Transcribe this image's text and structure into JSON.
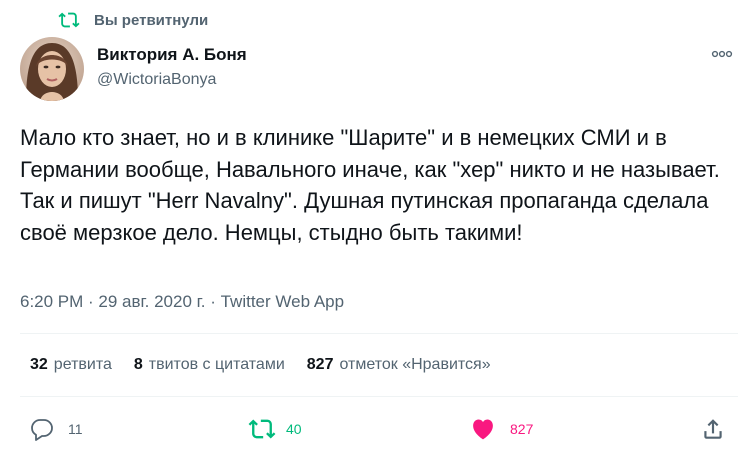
{
  "context": {
    "label": "Вы ретвитнули",
    "icon": "retweet-icon"
  },
  "author": {
    "name": "Виктория А. Боня",
    "handle": "@WictoriaBonya",
    "avatar": "avatar-photo"
  },
  "tweet": {
    "text": "Мало кто знает, но и в клинике \"Шарите\" и в немецких СМИ и в Германии вообще, Навального иначе, как \"хер\" никто и не называет. Так и пишут \"Herr Navalny\". Душная путинская пропаганда сделала своё мерзкое дело. Немцы, стыдно быть такими!",
    "timestamp": "6:20 PM · 29 авг. 2020 г. · Twitter Web App"
  },
  "stats": {
    "retweets": {
      "count": "32",
      "label": "ретвита"
    },
    "quotes": {
      "count": "8",
      "label": "твитов с цитатами"
    },
    "likes": {
      "count": "827",
      "label": "отметок «Нравится»"
    }
  },
  "actions": {
    "reply": {
      "icon": "reply-icon",
      "count": "11"
    },
    "retweet": {
      "icon": "retweet-icon",
      "count": "40",
      "active": true
    },
    "like": {
      "icon": "heart-icon",
      "count": "827",
      "active": true
    },
    "share": {
      "icon": "share-icon"
    }
  },
  "colors": {
    "text_primary": "#0f1419",
    "text_secondary": "#536471",
    "retweet_green": "#00ba7c",
    "like_pink": "#f91880"
  }
}
